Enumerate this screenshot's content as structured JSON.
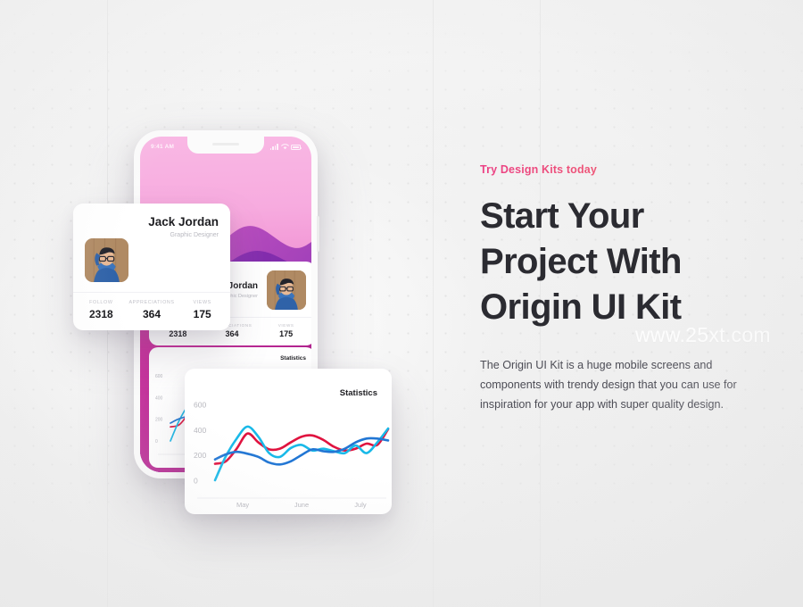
{
  "hero": {
    "eyebrow": "Try Design Kits today",
    "headline_lines": [
      "Start Your",
      "Project With",
      "Origin UI Kit"
    ],
    "body": "The Origin UI Kit is a huge mobile screens and components with trendy design that you can use for inspiration for your app with super quality design.",
    "watermark": "www.25xt.com",
    "accent_color": "#ec3f84",
    "headline_color": "#2b2b31"
  },
  "phone": {
    "status_bar": {
      "time": "9:41 AM",
      "icons": [
        "signal-bars-icon",
        "wifi-icon",
        "battery-icon"
      ]
    },
    "wallpaper_colors": [
      "#f9b8e4",
      "#e263bd",
      "#a8126f",
      "#6e2fa8",
      "#8d0a55"
    ]
  },
  "profile_card": {
    "name": "Jack Jordan",
    "role": "Graphic Designer",
    "avatar_alt": "avatar",
    "stats": [
      {
        "label": "FOLLOW",
        "value": "2318"
      },
      {
        "label": "APPRECIATIONS",
        "value": "364"
      },
      {
        "label": "VIEWS",
        "value": "175"
      }
    ]
  },
  "chart_data": {
    "type": "line",
    "title": "Statistics",
    "xlabel": "",
    "ylabel": "",
    "ylim": [
      0,
      700
    ],
    "yticks": [
      0,
      200,
      400,
      600
    ],
    "categories": [
      "May",
      "June",
      "July"
    ],
    "xticks": [
      "May",
      "June",
      "July"
    ],
    "grid": false,
    "legend": "none",
    "x": [
      0,
      1,
      2,
      3,
      4,
      5,
      6,
      7,
      8,
      9,
      10,
      11,
      12,
      13,
      14,
      15,
      16
    ],
    "series": [
      {
        "name": "series-crimson",
        "color": "#e0133f",
        "values": [
          130,
          150,
          250,
          370,
          300,
          245,
          250,
          300,
          345,
          355,
          320,
          265,
          235,
          250,
          290,
          280,
          405
        ]
      },
      {
        "name": "series-cyan",
        "color": "#19b9e8",
        "values": [
          0,
          190,
          330,
          425,
          345,
          215,
          185,
          255,
          280,
          235,
          250,
          230,
          215,
          275,
          215,
          300,
          410
        ]
      },
      {
        "name": "series-blue",
        "color": "#2176d4",
        "values": [
          165,
          205,
          225,
          210,
          185,
          140,
          125,
          150,
          200,
          245,
          230,
          225,
          250,
          300,
          330,
          330,
          315
        ]
      }
    ]
  }
}
